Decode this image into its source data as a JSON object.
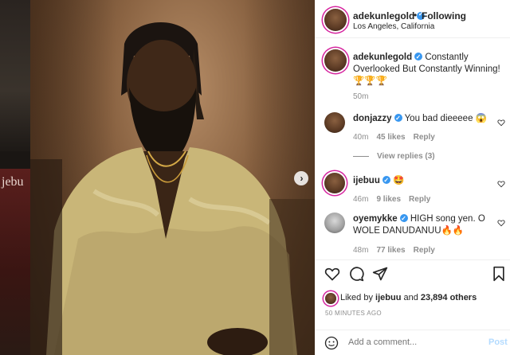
{
  "backdrop": {
    "left_text": "jebu"
  },
  "post": {
    "username": "adekunlegold",
    "follow_separator": "•",
    "follow_status": "Following",
    "location": "Los Angeles, California",
    "caption": "Constantly Overlooked But Constantly Winning! 🏆🏆🏆",
    "caption_time": "50m"
  },
  "comments": [
    {
      "username": "donjazzy",
      "text": "You bad dieeeee 😱",
      "time": "40m",
      "likes": "45 likes",
      "reply": "Reply"
    },
    {
      "username": "ijebuu",
      "text": "🤩",
      "time": "46m",
      "likes": "9 likes",
      "reply": "Reply"
    },
    {
      "username": "oyemykke",
      "text": "HIGH song yen. O WOLE DANUDANUU🔥🔥",
      "time": "48m",
      "likes": "77 likes",
      "reply": "Reply"
    }
  ],
  "view_replies": "View replies (3)",
  "likes_summary": {
    "prefix": "Liked by ",
    "user": "ijebuu",
    "middle": " and ",
    "count": "23,894 others"
  },
  "timestamp": "50 MINUTES AGO",
  "add_comment": {
    "placeholder": "Add a comment...",
    "post_label": "Post"
  },
  "icons": [
    "heart-icon",
    "comment-icon",
    "share-icon",
    "bookmark-icon",
    "emoji-icon",
    "chevron-right-icon"
  ]
}
